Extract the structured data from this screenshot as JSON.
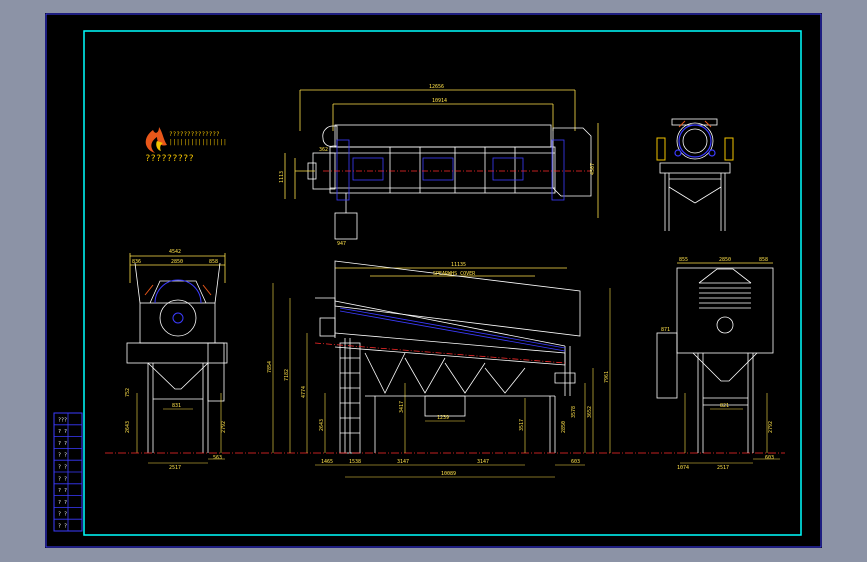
{
  "colors": {
    "background": "#8c93a6",
    "sheet": "#000000",
    "frame": "#00ffff",
    "outer_border": "#3b3bff",
    "geometry": "#ffffff",
    "dimension": "#ffe24a",
    "centerline": "#ff2a2a",
    "structure": "#00ff66"
  },
  "logo": {
    "chars": "??????????????",
    "caption": "?????????"
  },
  "title_block": {
    "rows": [
      "???",
      "? ?",
      "? ?",
      "? ?",
      "? ?",
      "? ?",
      "? ?",
      "? ?",
      "? ?",
      "? ?"
    ]
  },
  "top_view": {
    "dims": {
      "overall": "12656",
      "inner": "10914",
      "height": "4507",
      "left_h": "1113",
      "small": "362",
      "bottom": "947"
    }
  },
  "left_view": {
    "dims": {
      "overall": "4542",
      "left": "836",
      "mid": "2850",
      "right": "858",
      "base": "2517",
      "offset": "563",
      "tall1": "2643",
      "tall2": "2792",
      "small": "752",
      "inner": "831"
    }
  },
  "front_view": {
    "label": "SPEARWHS COVER",
    "dims": {
      "overall": "11135",
      "h1": "7854",
      "h2": "7182",
      "h3": "4774",
      "h4": "2643",
      "h5": "3417",
      "h6": "3517",
      "h7": "2850",
      "h8": "3578",
      "h9": "3652",
      "h10": "7961",
      "hopper": "1239",
      "b1": "1465",
      "b2": "1538",
      "b3": "3147",
      "b4": "3147",
      "b5": "603",
      "total": "10089"
    }
  },
  "top_right_view": {
    "dims": {}
  },
  "right_view": {
    "dims": {
      "left": "855",
      "mid": "2850",
      "right": "858",
      "base": "2517",
      "b_left": "1074",
      "offset": "603",
      "small": "871",
      "tall": "2792",
      "inner": "821"
    }
  }
}
